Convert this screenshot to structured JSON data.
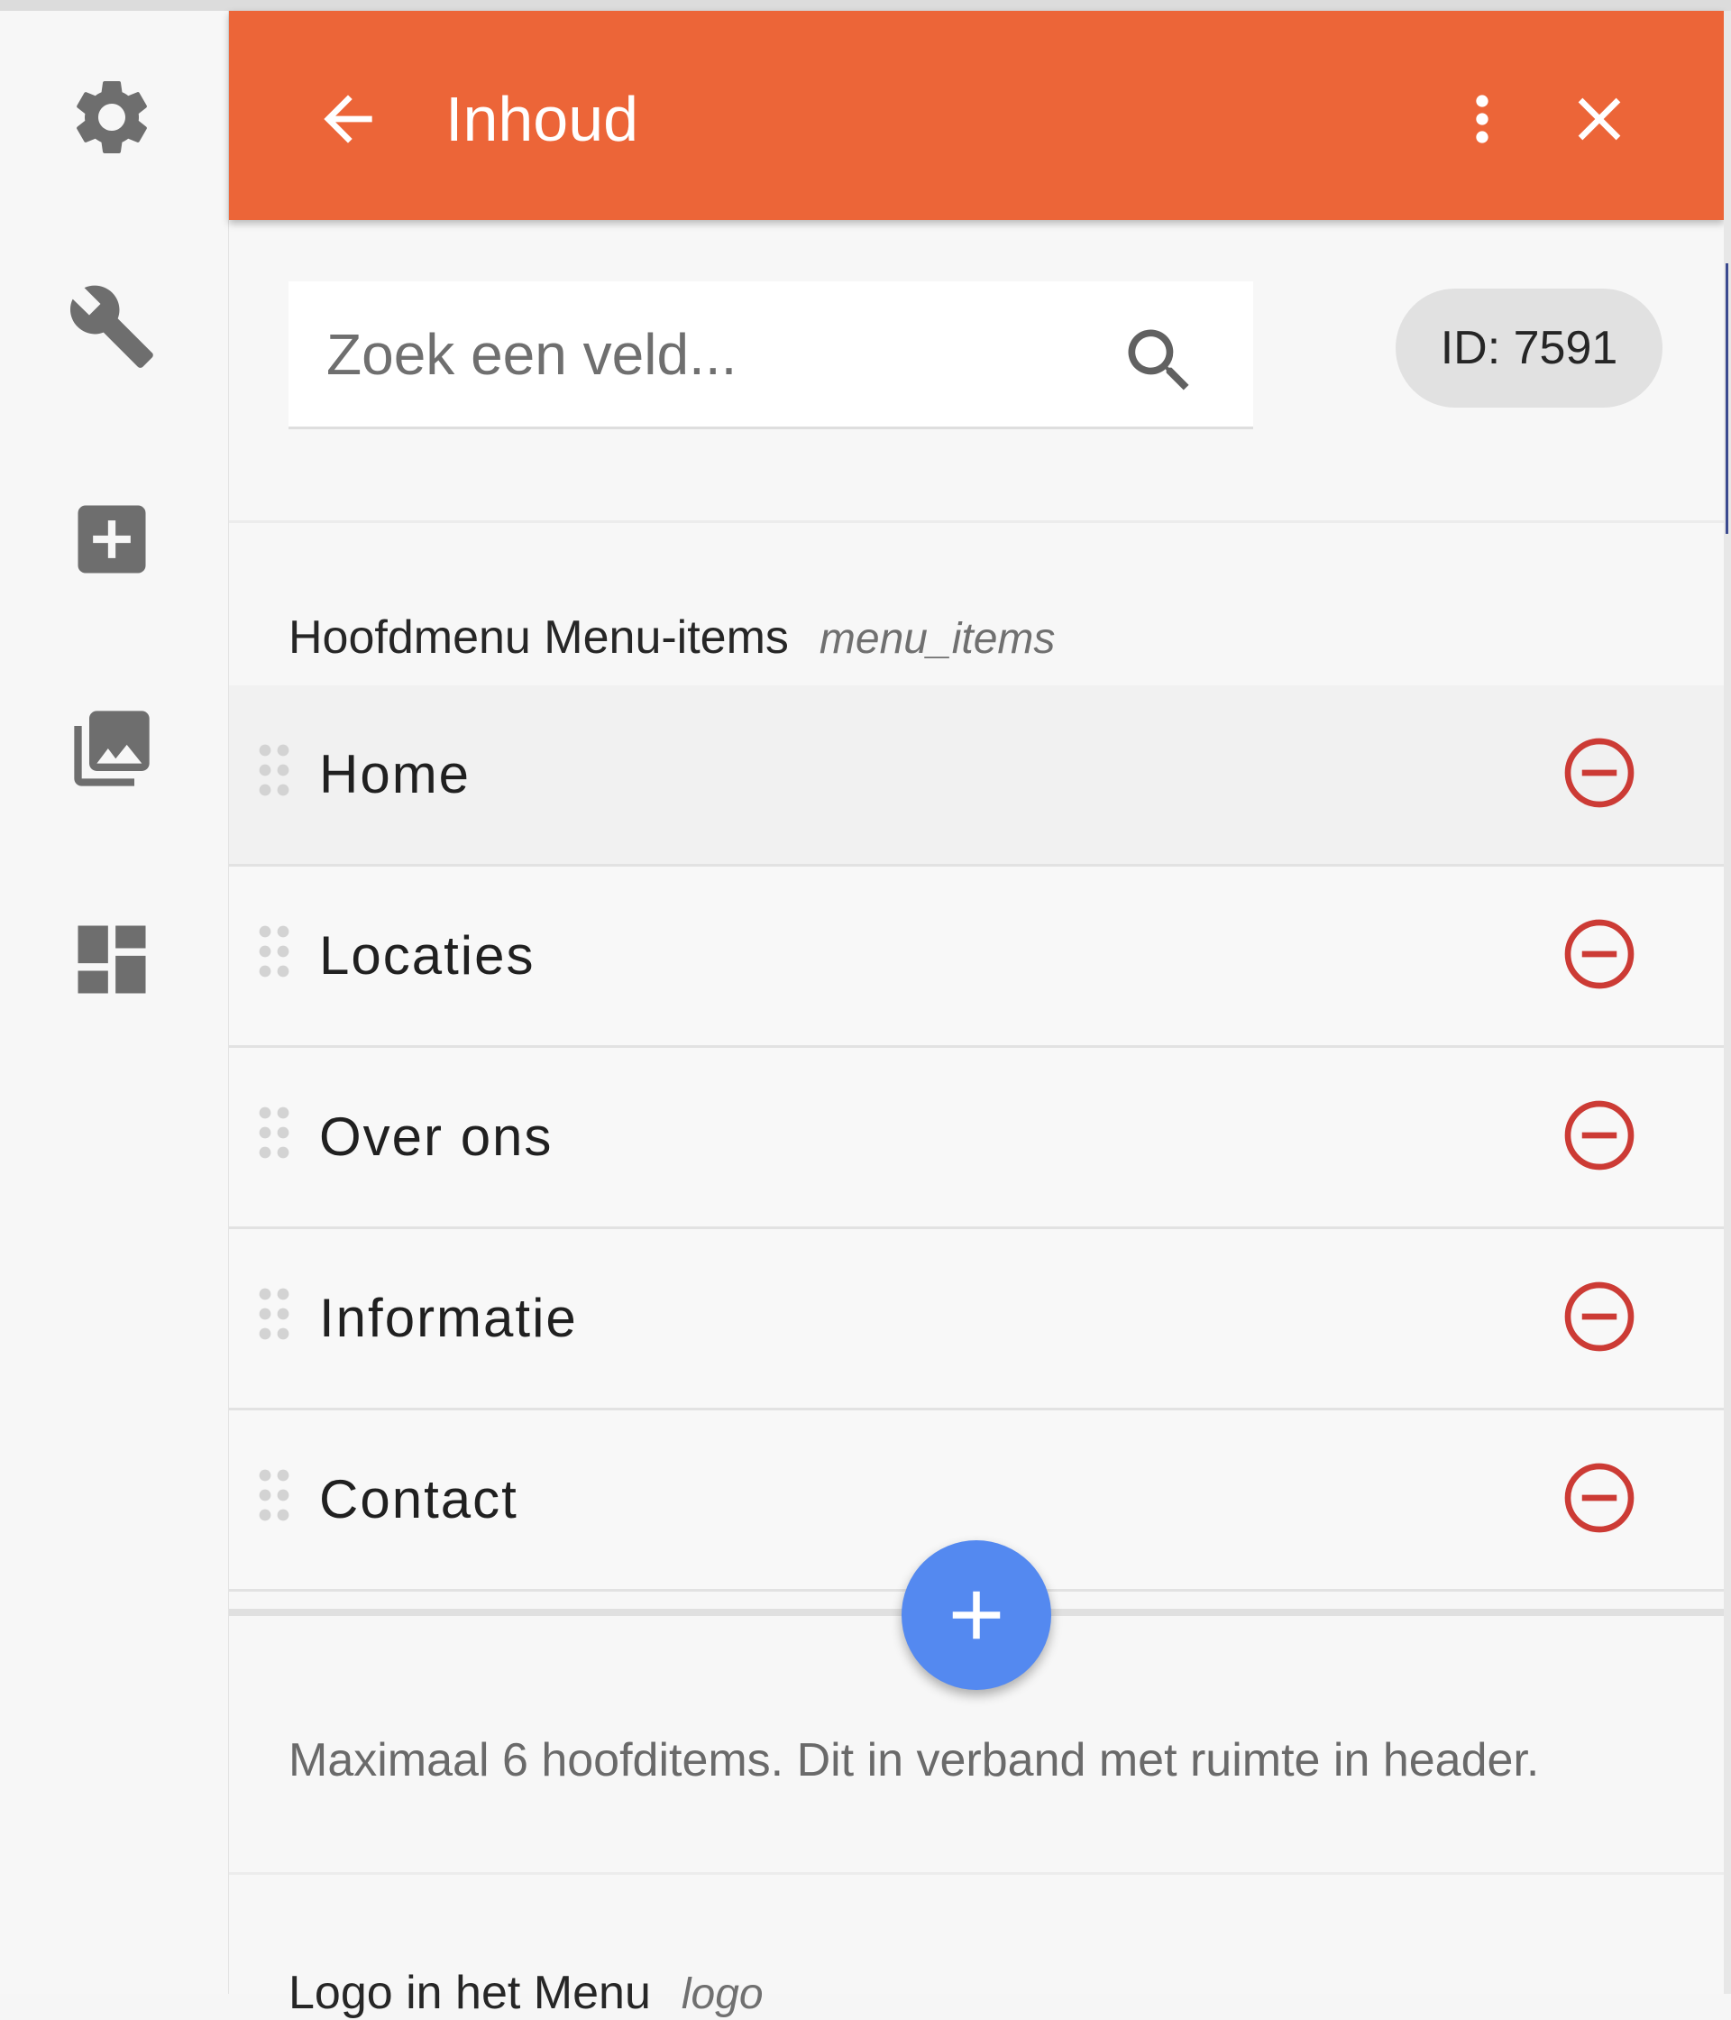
{
  "header": {
    "title": "Inhoud"
  },
  "search": {
    "placeholder": "Zoek een veld..."
  },
  "record": {
    "id_label": "ID: 7591"
  },
  "section": {
    "label": "Hoofdmenu Menu-items",
    "key": "menu_items"
  },
  "menu_items": [
    {
      "label": "Home"
    },
    {
      "label": "Locaties"
    },
    {
      "label": "Over ons"
    },
    {
      "label": "Informatie"
    },
    {
      "label": "Contact"
    }
  ],
  "hint": "Maximaal 6 hoofditems. Dit in verband met ruimte in header.",
  "next_section": {
    "label": "Logo in het Menu",
    "key": "logo"
  },
  "icons": {
    "sidebar": [
      "gear-icon",
      "wrench-icon",
      "add-box-icon",
      "photo-library-icon",
      "dashboard-icon"
    ],
    "header": [
      "arrow-back-icon",
      "more-vert-icon",
      "close-icon"
    ]
  },
  "colors": {
    "header_bg": "#ec6538",
    "fab_bg": "#5489f0",
    "remove_red": "#cc3b35"
  }
}
